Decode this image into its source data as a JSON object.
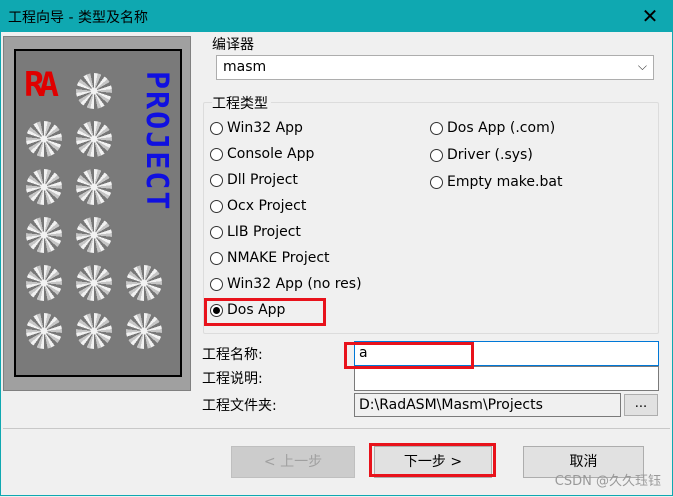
{
  "window": {
    "title": "工程向导 - 类型及名称",
    "close_glyph": "✕"
  },
  "picture": {
    "logo_text": "RA",
    "project_text": "PROJECT"
  },
  "compiler": {
    "label": "编译器",
    "selected": "masm",
    "arrow": "⌵"
  },
  "project_type": {
    "label": "工程类型",
    "options_left": [
      "Win32 App",
      "Console App",
      "Dll Project",
      "Ocx Project",
      "LIB Project",
      "NMAKE Project",
      "Win32 App (no res)",
      "Dos App"
    ],
    "options_right": [
      "Dos App (.com)",
      "Driver (.sys)",
      "Empty make.bat"
    ],
    "selected": "Dos App"
  },
  "fields": {
    "name_label": "工程名称:",
    "name_value": "a",
    "desc_label": "工程说明:",
    "desc_value": "",
    "folder_label": "工程文件夹:",
    "folder_value": "D:\\RadASM\\Masm\\Projects",
    "browse_label": "..."
  },
  "buttons": {
    "back": "< 上一步",
    "next": "下一步 >",
    "cancel": "取消"
  },
  "watermark": "CSDN @久久珏钰",
  "colors": {
    "titlebar": "#0fa8b1",
    "highlight": "#e8121b",
    "project_text": "#1010e0",
    "logo": "#e00000"
  }
}
